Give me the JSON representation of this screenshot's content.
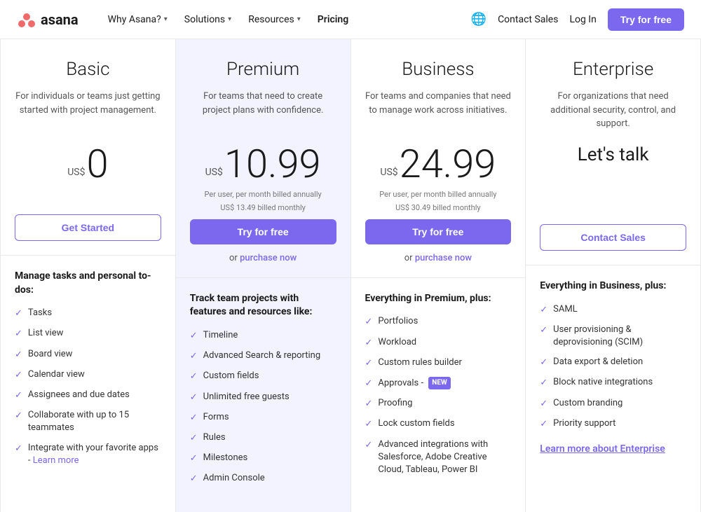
{
  "nav": {
    "logo_text": "asana",
    "links": [
      {
        "label": "Why Asana?",
        "has_dropdown": true
      },
      {
        "label": "Solutions",
        "has_dropdown": true
      },
      {
        "label": "Resources",
        "has_dropdown": true
      },
      {
        "label": "Pricing",
        "has_dropdown": false
      }
    ],
    "contact_sales": "Contact Sales",
    "login": "Log In",
    "try_btn": "Try for free"
  },
  "plans": [
    {
      "id": "basic",
      "name": "Basic",
      "desc": "For individuals or teams just getting started with project management.",
      "price_prefix": "US$",
      "price": "0",
      "price_note1": "",
      "price_note2": "",
      "cta_type": "get_started",
      "cta_label": "Get Started",
      "features_header": "Manage tasks and personal to-dos:",
      "features": [
        {
          "text": "Tasks",
          "badge": null
        },
        {
          "text": "List view",
          "badge": null
        },
        {
          "text": "Board view",
          "badge": null
        },
        {
          "text": "Calendar view",
          "badge": null
        },
        {
          "text": "Assignees and due dates",
          "badge": null
        },
        {
          "text": "Collaborate with up to 15 teammates",
          "badge": null
        },
        {
          "text": "Integrate with your favorite apps - ",
          "badge": null,
          "link": "Learn more",
          "link_href": "#"
        }
      ]
    },
    {
      "id": "premium",
      "name": "Premium",
      "desc": "For teams that need to create project plans with confidence.",
      "price_prefix": "US$",
      "price": "10.99",
      "price_note1": "Per user, per month billed annually",
      "price_note2": "US$ 13.49 billed monthly",
      "cta_type": "try_free",
      "cta_label": "Try for free",
      "purchase_label": "or",
      "purchase_link": "purchase now",
      "features_header": "Track team projects with features and resources like:",
      "features": [
        {
          "text": "Timeline",
          "badge": null
        },
        {
          "text": "Advanced Search & reporting",
          "badge": null
        },
        {
          "text": "Custom fields",
          "badge": null
        },
        {
          "text": "Unlimited free guests",
          "badge": null
        },
        {
          "text": "Forms",
          "badge": null
        },
        {
          "text": "Rules",
          "badge": null
        },
        {
          "text": "Milestones",
          "badge": null
        },
        {
          "text": "Admin Console",
          "badge": null
        }
      ]
    },
    {
      "id": "business",
      "name": "Business",
      "desc": "For teams and companies that need to manage work across initiatives.",
      "price_prefix": "US$",
      "price": "24.99",
      "price_note1": "Per user, per month billed annually",
      "price_note2": "US$ 30.49 billed monthly",
      "cta_type": "try_free",
      "cta_label": "Try for free",
      "purchase_label": "or",
      "purchase_link": "purchase now",
      "features_header": "Everything in Premium, plus:",
      "features": [
        {
          "text": "Portfolios",
          "badge": null
        },
        {
          "text": "Workload",
          "badge": null
        },
        {
          "text": "Custom rules builder",
          "badge": null
        },
        {
          "text": "Approvals - ",
          "badge": "NEW"
        },
        {
          "text": "Proofing",
          "badge": null
        },
        {
          "text": "Lock custom fields",
          "badge": null
        },
        {
          "text": "Advanced integrations with Salesforce, Adobe Creative Cloud, Tableau, Power BI",
          "badge": null
        }
      ]
    },
    {
      "id": "enterprise",
      "name": "Enterprise",
      "desc": "For organizations that need additional security, control, and support.",
      "price_prefix": "",
      "price": "Let's talk",
      "price_note1": "",
      "price_note2": "",
      "cta_type": "contact_sales",
      "cta_label": "Contact Sales",
      "features_header": "Everything in Business, plus:",
      "features": [
        {
          "text": "SAML",
          "badge": null
        },
        {
          "text": "User provisioning & deprovisioning (SCIM)",
          "badge": null
        },
        {
          "text": "Data export & deletion",
          "badge": null
        },
        {
          "text": "Block native integrations",
          "badge": null
        },
        {
          "text": "Custom branding",
          "badge": null
        },
        {
          "text": "Priority support",
          "badge": null
        }
      ],
      "enterprise_link": "Learn more about Enterprise"
    }
  ]
}
